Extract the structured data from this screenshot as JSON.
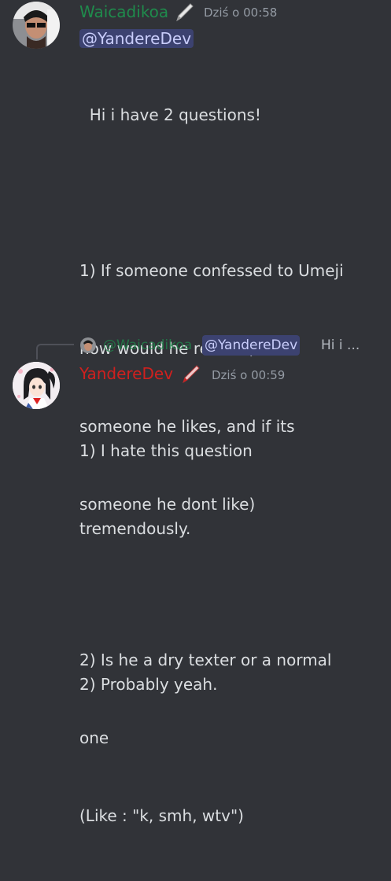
{
  "messages": [
    {
      "author": "Waicadikoa",
      "author_color": "#1f8b4c",
      "timestamp": "Dziś o 00:58",
      "mention": "@YandereDev",
      "lines": [
        "  Hi i have 2 questions!",
        "",
        "1) If someone confessed to Umeji",
        "how would he react? (If its",
        "someone he likes, and if its",
        "someone he dont like)",
        "",
        "2) Is he a dry texter or a normal",
        "one",
        "(Like : \"k, smh, wtv\")"
      ]
    },
    {
      "author": "YandereDev",
      "author_color": "#d0201e",
      "timestamp": "Dziś o 00:59",
      "reply": {
        "author": "@Waicadikoa",
        "mention": "@YandereDev",
        "snippet": "Hi i ..."
      },
      "lines": [
        "1) I hate this question",
        "tremendously.",
        "",
        "2) Probably yeah."
      ]
    }
  ],
  "icons": {
    "role_icon": "pen-icon",
    "avatar_1": "avatar-portrait",
    "avatar_2": "avatar-anime-girl"
  }
}
